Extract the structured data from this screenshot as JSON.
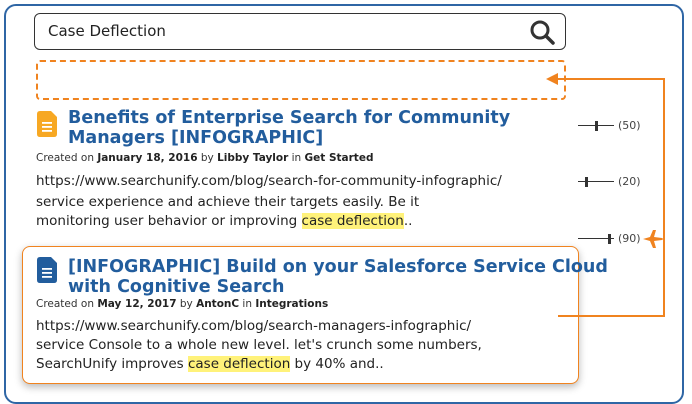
{
  "search": {
    "value": "Case Deflection",
    "icon": "search-icon"
  },
  "results": [
    {
      "title_line1": "Benefits of Enterprise Search for Community",
      "title_line2": "Managers [INFOGRAPHIC]",
      "meta_prefix": "Created on ",
      "date": "January 18, 2016",
      "by": " by ",
      "author": "Libby Taylor",
      "in": " in ",
      "category": "Get Started",
      "url": "https://www.searchunify.com/blog/search-for-community-infographic/",
      "snippet_line1": "service experience and achieve their targets easily. Be it",
      "snippet_line2_before": "monitoring user behavior or improving ",
      "snippet_highlight": "case deflection",
      "snippet_line2_after": ".."
    },
    {
      "title_line1": "[INFOGRAPHIC] Build on your Salesforce Service Cloud",
      "title_line2": "with Cognitive Search",
      "meta_prefix": "Created on ",
      "date": "May 12, 2017",
      "by": " by ",
      "author": "AntonC",
      "in": " in ",
      "category": "Integrations",
      "url": "https://www.searchunify.com/blog/search-managers-infographic/",
      "snippet_line1": "service Console to a whole new level. let's crunch some numbers,",
      "snippet_line2_before": "SearchUnify improves ",
      "snippet_highlight": "case deflection",
      "snippet_line2_after": " by 40% and.."
    }
  ],
  "scores": [
    {
      "label": "(50)",
      "value": 50
    },
    {
      "label": "(20)",
      "value": 20
    },
    {
      "label": "(90)",
      "value": 90
    }
  ],
  "colors": {
    "frame": "#2f66a5",
    "accent": "#f0831f",
    "title": "#225d9d",
    "highlight": "#fff27a"
  }
}
